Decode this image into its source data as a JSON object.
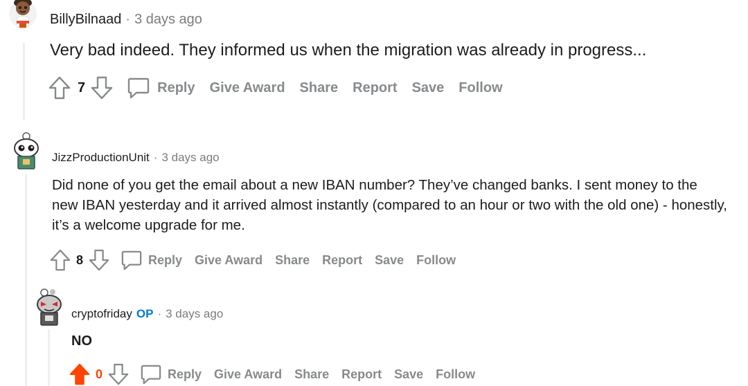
{
  "comments": [
    {
      "username": "BillyBilnaad",
      "separator": "·",
      "time": "3 days ago",
      "body": "Very bad indeed. They informed us when the migration was already in progress...",
      "votes": "7",
      "upvoted": false
    },
    {
      "username": "JizzProductionUnit",
      "separator": "·",
      "time": "3 days ago",
      "body": "Did none of you get the email about a new IBAN number? They’ve changed banks. I sent money to the new IBAN yesterday and it arrived almost instantly (compared to an hour or two with the old one) - honestly, it’s a welcome upgrade for me.",
      "votes": "8",
      "upvoted": false
    },
    {
      "username": "cryptofriday",
      "badge": "OP",
      "separator": "·",
      "time": "3 days ago",
      "body": "NO",
      "votes": "0",
      "upvoted": true
    }
  ],
  "actions": {
    "reply": "Reply",
    "give_award": "Give Award",
    "share": "Share",
    "report": "Report",
    "save": "Save",
    "follow": "Follow"
  },
  "colors": {
    "upvote_active": "#ff4500",
    "vote_count_active": "#ff4500",
    "op_badge": "#0079d3",
    "action_text": "#878a8c",
    "thread_line": "#edeff1"
  },
  "icons": [
    "upvote-icon",
    "downvote-icon",
    "comment-bubble-icon"
  ]
}
